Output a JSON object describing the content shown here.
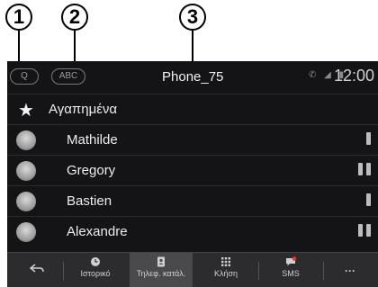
{
  "callouts": [
    "1",
    "2",
    "3"
  ],
  "header": {
    "search_label": "Q",
    "abc_label": "ABC",
    "title": "Phone_75",
    "status_icons": "✆ ◢ ▮",
    "time": "12:00"
  },
  "favorites": {
    "label": "Αγαπημένα"
  },
  "contacts": [
    {
      "name": "Mathilde",
      "devices": 1
    },
    {
      "name": "Gregory",
      "devices": 2
    },
    {
      "name": "Bastien",
      "devices": 1
    },
    {
      "name": "Alexandre",
      "devices": 2
    }
  ],
  "bottom_tabs": {
    "history": "Ιστορικό",
    "contacts": "Τηλεφ. κατάλ.",
    "call": "Κλήση",
    "sms": "SMS",
    "more": "···"
  },
  "colors": {
    "screen_bg": "#141416",
    "bar_bg": "#2c2c2e",
    "sms_accent": "#e6392f"
  }
}
